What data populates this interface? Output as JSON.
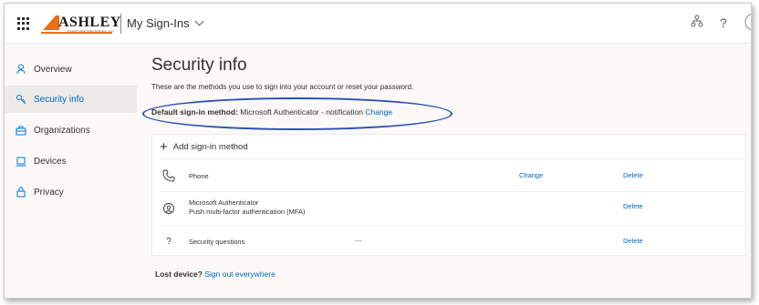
{
  "header": {
    "brand": "ASHLEY",
    "brand_sub": "FURNITURE INDUSTRIES, LLC",
    "app_title": "My Sign-Ins",
    "help_glyph": "?",
    "icons": [
      "waffle-icon",
      "org-chart-icon",
      "help-icon"
    ]
  },
  "sidebar": {
    "items": [
      {
        "label": "Overview",
        "icon": "person-icon"
      },
      {
        "label": "Security info",
        "icon": "key-icon",
        "active": true
      },
      {
        "label": "Organizations",
        "icon": "briefcase-icon"
      },
      {
        "label": "Devices",
        "icon": "laptop-icon"
      },
      {
        "label": "Privacy",
        "icon": "lock-icon"
      }
    ]
  },
  "main": {
    "title": "Security info",
    "description": "These are the methods you use to sign into your account or reset your password.",
    "default_label": "Default sign-in method:",
    "default_value": "Microsoft Authenticator - notification",
    "default_change": "Change",
    "add_method": "Add sign-in method",
    "methods": [
      {
        "name": "Phone",
        "detail": "",
        "change": "Change",
        "delete": "Delete",
        "icon": "phone-icon"
      },
      {
        "name": "Microsoft Authenticator",
        "subtitle": "Push multi-factor authentication (MFA)",
        "detail": "",
        "delete": "Delete",
        "icon": "authenticator-icon"
      },
      {
        "name": "Security questions",
        "detail": "---",
        "delete": "Delete",
        "icon": "question-icon",
        "glyph": "?"
      }
    ],
    "lost_label": "Lost device?",
    "lost_link": "Sign out everywhere"
  },
  "colors": {
    "accent": "#0067b8",
    "annotation": "#2b4fb5",
    "logo_orange": "#e8701c"
  }
}
